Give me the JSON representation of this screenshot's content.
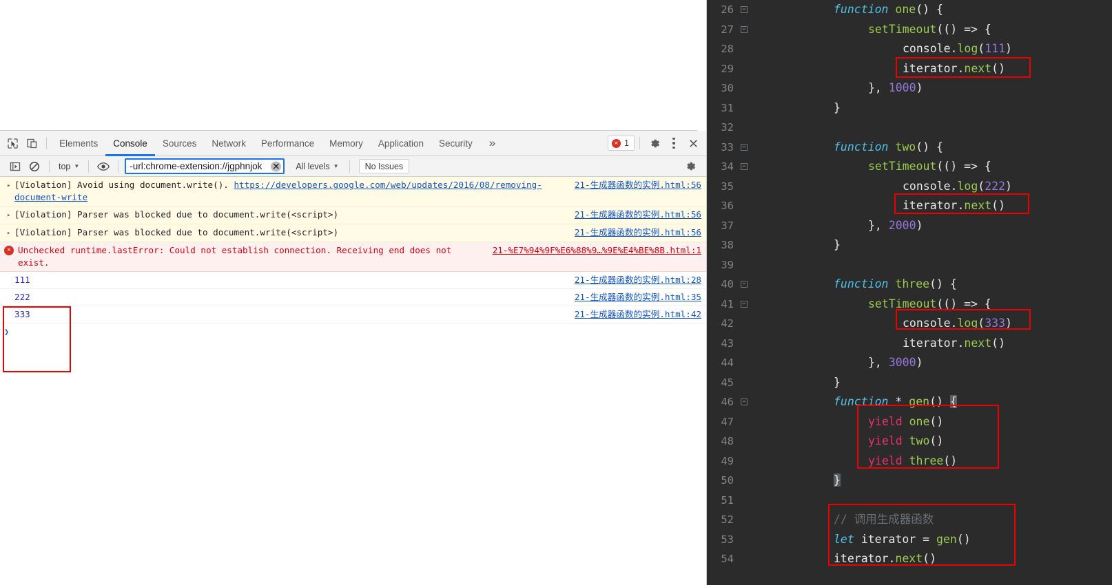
{
  "devtools": {
    "toolbar_icons": [
      {
        "name": "inspect-element-icon",
        "glyph": "inspect"
      },
      {
        "name": "device-toolbar-icon",
        "glyph": "device"
      }
    ],
    "tabs": [
      {
        "label": "Elements",
        "active": false
      },
      {
        "label": "Console",
        "active": true
      },
      {
        "label": "Sources",
        "active": false
      },
      {
        "label": "Network",
        "active": false
      },
      {
        "label": "Performance",
        "active": false
      },
      {
        "label": "Memory",
        "active": false
      },
      {
        "label": "Application",
        "active": false
      },
      {
        "label": "Security",
        "active": false
      }
    ],
    "more_tabs_label": "»",
    "error_badge": {
      "count": "1",
      "icon": "error-circle-icon",
      "glyph": "×"
    },
    "settings_icon": "gear-icon",
    "menu_icon": "kebab-menu-icon",
    "close_icon": "close-icon",
    "filterbar": {
      "execute_icon": "console-sidebar-icon",
      "clear_icon": "clear-console-icon",
      "context": "top",
      "context_caret": "▼",
      "eye_icon": "live-expression-icon",
      "filter_value": "-url:chrome-extension://jgphnjok",
      "filter_placeholder": "Filter",
      "filter_clear_glyph": "✕",
      "level": "All levels",
      "level_caret": "▼",
      "issues_label": "No Issues",
      "settings_icon": "gear-icon"
    }
  },
  "console": {
    "messages": [
      {
        "level": "warn",
        "disclosure": "▸",
        "text_before": "[Violation] Avoid using document.write(). ",
        "link_text": "https://developers.google.com/web/updates/2016/08/removing-document-write",
        "text_after": "",
        "source": "21-生成器函数的实例.html:56"
      },
      {
        "level": "warn",
        "disclosure": "▸",
        "text_before": "[Violation] Parser was blocked due to document.write(<script>)",
        "link_text": "",
        "text_after": "",
        "source": "21-生成器函数的实例.html:56"
      },
      {
        "level": "warn",
        "disclosure": "▸",
        "text_before": "[Violation] Parser was blocked due to document.write(<script>)",
        "link_text": "",
        "text_after": "",
        "source": "21-生成器函数的实例.html:56"
      },
      {
        "level": "error",
        "icon": "error-circle-icon",
        "text_before": "Unchecked runtime.lastError: Could not establish connection. Receiving end does not exist.",
        "link_text": "",
        "text_after": "",
        "source": "21-%E7%94%9F%E6%88%9…%9E%E4%BE%8B.html:1"
      },
      {
        "level": "log",
        "text_before": "111",
        "link_text": "",
        "text_after": "",
        "source": "21-生成器函数的实例.html:28"
      },
      {
        "level": "log",
        "text_before": "222",
        "link_text": "",
        "text_after": "",
        "source": "21-生成器函数的实例.html:35"
      },
      {
        "level": "log",
        "text_before": "333",
        "link_text": "",
        "text_after": "",
        "source": "21-生成器函数的实例.html:42"
      }
    ],
    "prompt_chevron": "❯"
  },
  "editor": {
    "first_line_number": 26,
    "lines": [
      {
        "n": "26",
        "fold": true,
        "indent": 0,
        "tokens": [
          {
            "t": "kw",
            "v": "function"
          },
          {
            "t": "plain",
            "v": " "
          },
          {
            "t": "green",
            "v": "one"
          },
          {
            "t": "plain",
            "v": "() {"
          }
        ]
      },
      {
        "n": "27",
        "fold": true,
        "indent": 1,
        "tokens": [
          {
            "t": "green",
            "v": "setTimeout"
          },
          {
            "t": "plain",
            "v": "(() => {"
          }
        ]
      },
      {
        "n": "28",
        "fold": false,
        "indent": 2,
        "tokens": [
          {
            "t": "plain",
            "v": "console."
          },
          {
            "t": "green",
            "v": "log"
          },
          {
            "t": "plain",
            "v": "("
          },
          {
            "t": "num",
            "v": "111"
          },
          {
            "t": "plain",
            "v": ")"
          }
        ]
      },
      {
        "n": "29",
        "fold": false,
        "indent": 2,
        "tokens": [
          {
            "t": "plain",
            "v": "iterator."
          },
          {
            "t": "green",
            "v": "next"
          },
          {
            "t": "plain",
            "v": "()"
          }
        ]
      },
      {
        "n": "30",
        "fold": false,
        "indent": 1,
        "tokens": [
          {
            "t": "plain",
            "v": "}, "
          },
          {
            "t": "num",
            "v": "1000"
          },
          {
            "t": "plain",
            "v": ")"
          }
        ]
      },
      {
        "n": "31",
        "fold": false,
        "indent": 0,
        "tokens": [
          {
            "t": "plain",
            "v": "}"
          }
        ]
      },
      {
        "n": "32",
        "fold": false,
        "indent": 0,
        "tokens": []
      },
      {
        "n": "33",
        "fold": true,
        "indent": 0,
        "tokens": [
          {
            "t": "kw",
            "v": "function"
          },
          {
            "t": "plain",
            "v": " "
          },
          {
            "t": "green",
            "v": "two"
          },
          {
            "t": "plain",
            "v": "() {"
          }
        ]
      },
      {
        "n": "34",
        "fold": true,
        "indent": 1,
        "tokens": [
          {
            "t": "green",
            "v": "setTimeout"
          },
          {
            "t": "plain",
            "v": "(() => {"
          }
        ]
      },
      {
        "n": "35",
        "fold": false,
        "indent": 2,
        "tokens": [
          {
            "t": "plain",
            "v": "console."
          },
          {
            "t": "green",
            "v": "log"
          },
          {
            "t": "plain",
            "v": "("
          },
          {
            "t": "num",
            "v": "222"
          },
          {
            "t": "plain",
            "v": ")"
          }
        ]
      },
      {
        "n": "36",
        "fold": false,
        "indent": 2,
        "tokens": [
          {
            "t": "plain",
            "v": "iterator."
          },
          {
            "t": "green",
            "v": "next"
          },
          {
            "t": "plain",
            "v": "()"
          }
        ]
      },
      {
        "n": "37",
        "fold": false,
        "indent": 1,
        "tokens": [
          {
            "t": "plain",
            "v": "}, "
          },
          {
            "t": "num",
            "v": "2000"
          },
          {
            "t": "plain",
            "v": ")"
          }
        ]
      },
      {
        "n": "38",
        "fold": false,
        "indent": 0,
        "tokens": [
          {
            "t": "plain",
            "v": "}"
          }
        ]
      },
      {
        "n": "39",
        "fold": false,
        "indent": 0,
        "tokens": []
      },
      {
        "n": "40",
        "fold": true,
        "indent": 0,
        "tokens": [
          {
            "t": "kw",
            "v": "function"
          },
          {
            "t": "plain",
            "v": " "
          },
          {
            "t": "green",
            "v": "three"
          },
          {
            "t": "plain",
            "v": "() {"
          }
        ]
      },
      {
        "n": "41",
        "fold": true,
        "indent": 1,
        "tokens": [
          {
            "t": "green",
            "v": "setTimeout"
          },
          {
            "t": "plain",
            "v": "(() => {"
          }
        ]
      },
      {
        "n": "42",
        "fold": false,
        "indent": 2,
        "tokens": [
          {
            "t": "plain",
            "v": "console."
          },
          {
            "t": "green",
            "v": "log"
          },
          {
            "t": "plain",
            "v": "("
          },
          {
            "t": "num",
            "v": "333"
          },
          {
            "t": "plain",
            "v": ")"
          }
        ]
      },
      {
        "n": "43",
        "fold": false,
        "indent": 2,
        "tokens": [
          {
            "t": "plain",
            "v": "iterator."
          },
          {
            "t": "green",
            "v": "next"
          },
          {
            "t": "plain",
            "v": "()"
          }
        ]
      },
      {
        "n": "44",
        "fold": false,
        "indent": 1,
        "tokens": [
          {
            "t": "plain",
            "v": "}, "
          },
          {
            "t": "num",
            "v": "3000"
          },
          {
            "t": "plain",
            "v": ")"
          }
        ]
      },
      {
        "n": "45",
        "fold": false,
        "indent": 0,
        "tokens": [
          {
            "t": "plain",
            "v": "}"
          }
        ]
      },
      {
        "n": "46",
        "fold": true,
        "indent": 0,
        "tokens": [
          {
            "t": "kw",
            "v": "function"
          },
          {
            "t": "plain",
            "v": " * "
          },
          {
            "t": "green",
            "v": "gen"
          },
          {
            "t": "plain",
            "v": "() "
          },
          {
            "t": "bracehl",
            "v": "{"
          }
        ]
      },
      {
        "n": "47",
        "fold": false,
        "indent": 1,
        "tokens": [
          {
            "t": "yield",
            "v": "yield"
          },
          {
            "t": "plain",
            "v": " "
          },
          {
            "t": "green",
            "v": "one"
          },
          {
            "t": "plain",
            "v": "()"
          }
        ]
      },
      {
        "n": "48",
        "fold": false,
        "indent": 1,
        "tokens": [
          {
            "t": "yield",
            "v": "yield"
          },
          {
            "t": "plain",
            "v": " "
          },
          {
            "t": "green",
            "v": "two"
          },
          {
            "t": "plain",
            "v": "()"
          }
        ]
      },
      {
        "n": "49",
        "fold": false,
        "indent": 1,
        "tokens": [
          {
            "t": "yield",
            "v": "yield"
          },
          {
            "t": "plain",
            "v": " "
          },
          {
            "t": "green",
            "v": "three"
          },
          {
            "t": "plain",
            "v": "()"
          }
        ]
      },
      {
        "n": "50",
        "fold": false,
        "indent": 0,
        "tokens": [
          {
            "t": "bracehl",
            "v": "}"
          }
        ]
      },
      {
        "n": "51",
        "fold": false,
        "indent": 0,
        "tokens": []
      },
      {
        "n": "52",
        "fold": false,
        "indent": 0,
        "tokens": [
          {
            "t": "cmt",
            "v": "// 调用生成器函数"
          }
        ]
      },
      {
        "n": "53",
        "fold": false,
        "indent": 0,
        "tokens": [
          {
            "t": "kw",
            "v": "let"
          },
          {
            "t": "plain",
            "v": " iterator = "
          },
          {
            "t": "green",
            "v": "gen"
          },
          {
            "t": "plain",
            "v": "()"
          }
        ]
      },
      {
        "n": "54",
        "fold": false,
        "indent": 0,
        "tokens": [
          {
            "t": "plain",
            "v": "iterator."
          },
          {
            "t": "green",
            "v": "next"
          },
          {
            "t": "plain",
            "v": "()"
          }
        ]
      }
    ]
  },
  "colors": {
    "annotation_red": "#ee0000",
    "editor_bg": "#2b2b2b",
    "keyword_blue": "#4fc1e9",
    "identifier_green": "#9bcc4e",
    "number_purple": "#9876e0",
    "yield_pink": "#e9316b",
    "comment_gray": "#6a6f73",
    "devtools_accent": "#1a73e8",
    "error_red": "#d93025",
    "warn_bg": "#fffbe5",
    "error_bg": "#fff0f0"
  }
}
